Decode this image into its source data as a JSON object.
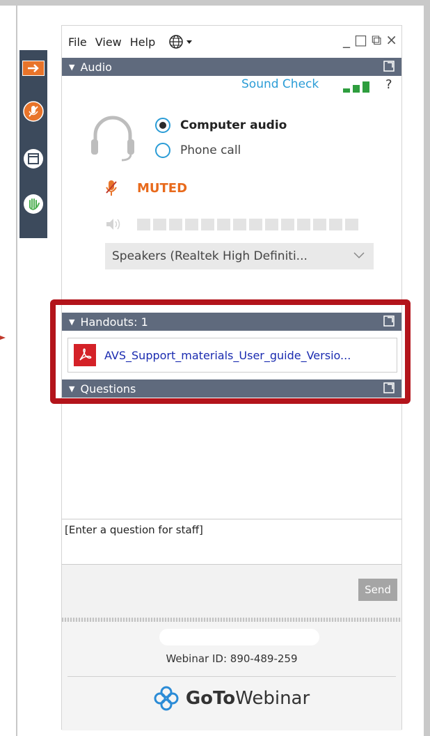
{
  "menu": {
    "items": [
      "File",
      "View",
      "Help"
    ],
    "window_controls": [
      "_",
      "□",
      "⧉",
      "×"
    ]
  },
  "audio": {
    "header": "Audio",
    "sound_check": "Sound Check",
    "help": "?",
    "options": [
      {
        "label": "Computer audio",
        "selected": true
      },
      {
        "label": "Phone call",
        "selected": false
      }
    ],
    "mute_status": "MUTED",
    "volume_level": 0,
    "volume_segments": 14,
    "speaker_device": "Speakers (Realtek  High  Definiti..."
  },
  "handouts": {
    "header": "Handouts: 1",
    "files": [
      {
        "name": "AVS_Support_materials_User_guide_Versio...",
        "type": "pdf-icon"
      }
    ]
  },
  "questions": {
    "header": "Questions",
    "input_placeholder": "[Enter a question for staff]",
    "send_label": "Send"
  },
  "footer": {
    "webinar_id": "Webinar ID: 890-489-259",
    "brand_goto": "GoTo",
    "brand_webinar": "Webinar"
  },
  "colors": {
    "accent_blue": "#2a9cd6",
    "section_header": "#5f6a7d",
    "muted_orange": "#e86a1c",
    "highlight_red": "#b3141b",
    "strip_bg": "#3c4a5c"
  }
}
